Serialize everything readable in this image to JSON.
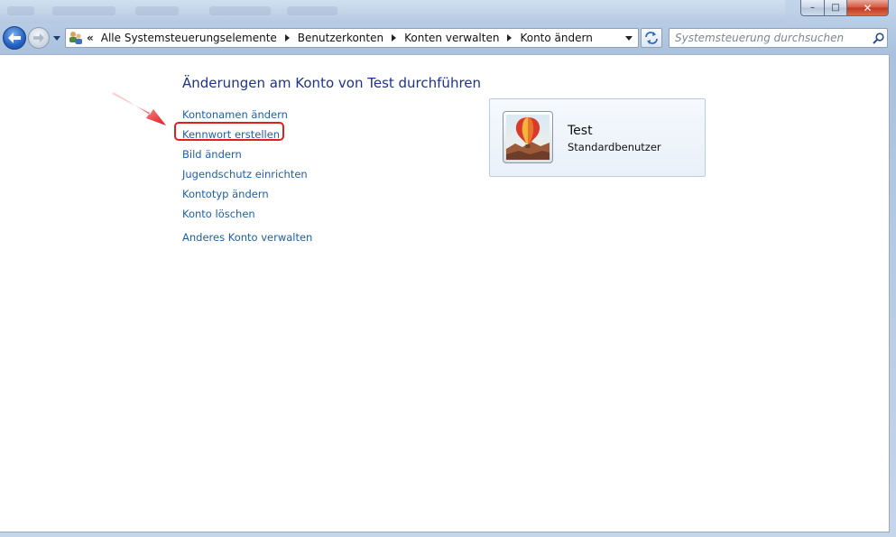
{
  "window": {
    "minimize_glyph": "–",
    "maximize_glyph": "□",
    "close_glyph": "✕"
  },
  "navigation": {
    "overflow_chevron": "«",
    "breadcrumbs": [
      "Alle Systemsteuerungselemente",
      "Benutzerkonten",
      "Konten verwalten",
      "Konto ändern"
    ],
    "search_placeholder": "Systemsteuerung durchsuchen",
    "icons": {
      "back": "back-arrow-icon",
      "forward": "forward-arrow-icon",
      "history": "chevron-down-icon",
      "address": "user-accounts-icon",
      "dropdown": "chevron-down-icon",
      "refresh": "refresh-icon",
      "search": "search-icon"
    }
  },
  "main": {
    "title": "Änderungen am Konto von Test durchführen",
    "tasks": [
      "Kontonamen ändern",
      "Kennwort erstellen",
      "Bild ändern",
      "Jugendschutz einrichten",
      "Kontotyp ändern",
      "Konto löschen"
    ],
    "other_task": "Anderes Konto verwalten",
    "highlighted_task": "Kennwort erstellen"
  },
  "account": {
    "name": "Test",
    "type": "Standardbenutzer",
    "picture_icon": "hot-air-balloon-icon"
  },
  "colors": {
    "link": "#1e5fa8",
    "title": "#1e3287",
    "highlight": "#e0201e",
    "card_border": "#b8cde2"
  }
}
